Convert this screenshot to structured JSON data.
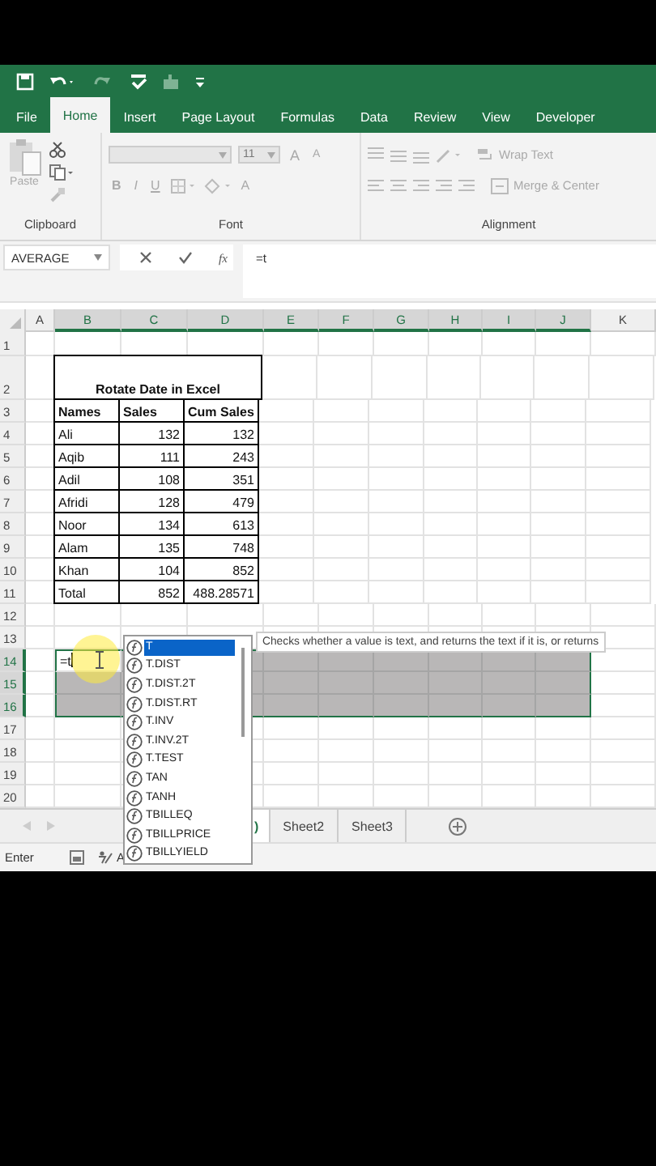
{
  "ribbon_tabs": [
    {
      "label": "File",
      "selected": false
    },
    {
      "label": "Home",
      "selected": true
    },
    {
      "label": "Insert",
      "selected": false
    },
    {
      "label": "Page Layout",
      "selected": false
    },
    {
      "label": "Formulas",
      "selected": false
    },
    {
      "label": "Data",
      "selected": false
    },
    {
      "label": "Review",
      "selected": false
    },
    {
      "label": "View",
      "selected": false
    },
    {
      "label": "Developer",
      "selected": false
    }
  ],
  "ribbon": {
    "paste_label": "Paste",
    "font_size": "11",
    "grow_font": "A",
    "shrink_font": "A",
    "bold": "B",
    "italic": "I",
    "underline": "U",
    "font_color": "A",
    "wrap_text": "Wrap Text",
    "merge_center": "Merge & Center",
    "groups": [
      {
        "label": "Clipboard"
      },
      {
        "label": "Font"
      },
      {
        "label": "Alignment"
      }
    ]
  },
  "formula_bar": {
    "name_box": "AVERAGE",
    "function_label": "fx",
    "formula": "=t"
  },
  "columns": [
    {
      "label": "A",
      "selected": false
    },
    {
      "label": "B",
      "selected": true
    },
    {
      "label": "C",
      "selected": true
    },
    {
      "label": "D",
      "selected": true
    },
    {
      "label": "E",
      "selected": true
    },
    {
      "label": "F",
      "selected": true
    },
    {
      "label": "G",
      "selected": true
    },
    {
      "label": "H",
      "selected": true
    },
    {
      "label": "I",
      "selected": true
    },
    {
      "label": "J",
      "selected": true
    },
    {
      "label": "K",
      "selected": false
    }
  ],
  "rows": [
    {
      "number": "1",
      "selected": false,
      "kind": "empty"
    },
    {
      "number": "2",
      "selected": false,
      "kind": "title",
      "cells": [
        "Rotate Date in Excel"
      ]
    },
    {
      "number": "3",
      "selected": false,
      "kind": "header",
      "cells": [
        "Names",
        "Sales",
        "Cum Sales"
      ]
    },
    {
      "number": "4",
      "selected": false,
      "kind": "body",
      "cells": [
        "Ali",
        "132",
        "132"
      ]
    },
    {
      "number": "5",
      "selected": false,
      "kind": "body",
      "cells": [
        "Aqib",
        "111",
        "243"
      ]
    },
    {
      "number": "6",
      "selected": false,
      "kind": "body",
      "cells": [
        "Adil",
        "108",
        "351"
      ]
    },
    {
      "number": "7",
      "selected": false,
      "kind": "body",
      "cells": [
        "Afridi",
        "128",
        "479"
      ]
    },
    {
      "number": "8",
      "selected": false,
      "kind": "body",
      "cells": [
        "Noor",
        "134",
        "613"
      ]
    },
    {
      "number": "9",
      "selected": false,
      "kind": "body",
      "cells": [
        "Alam",
        "135",
        "748"
      ]
    },
    {
      "number": "10",
      "selected": false,
      "kind": "body",
      "cells": [
        "Khan",
        "104",
        "852"
      ]
    },
    {
      "number": "11",
      "selected": false,
      "kind": "body",
      "cells": [
        "Total",
        "852",
        "488.28571"
      ]
    },
    {
      "number": "12",
      "selected": false,
      "kind": "empty"
    },
    {
      "number": "13",
      "selected": false,
      "kind": "empty"
    },
    {
      "number": "14",
      "selected": true,
      "kind": "input",
      "cells": [
        "=t"
      ]
    },
    {
      "number": "15",
      "selected": true,
      "kind": "empty"
    },
    {
      "number": "16",
      "selected": true,
      "kind": "empty"
    },
    {
      "number": "17",
      "selected": false,
      "kind": "empty"
    },
    {
      "number": "18",
      "selected": false,
      "kind": "empty"
    },
    {
      "number": "19",
      "selected": false,
      "kind": "empty"
    },
    {
      "number": "20",
      "selected": false,
      "kind": "empty"
    }
  ],
  "autocomplete": {
    "items": [
      {
        "label": "T",
        "selected": true
      },
      {
        "label": "T.DIST",
        "selected": false
      },
      {
        "label": "T.DIST.2T",
        "selected": false
      },
      {
        "label": "T.DIST.RT",
        "selected": false
      },
      {
        "label": "T.INV",
        "selected": false
      },
      {
        "label": "T.INV.2T",
        "selected": false
      },
      {
        "label": "T.TEST",
        "selected": false
      },
      {
        "label": "TAN",
        "selected": false
      },
      {
        "label": "TANH",
        "selected": false
      },
      {
        "label": "TBILLEQ",
        "selected": false
      },
      {
        "label": "TBILLPRICE",
        "selected": false
      },
      {
        "label": "TBILLYIELD",
        "selected": false
      }
    ],
    "tooltip": "Checks whether a value is text, and returns the text if it is, or returns"
  },
  "sheet_tabs": [
    {
      "label": ")",
      "selected": true
    },
    {
      "label": "Sheet2",
      "selected": false
    },
    {
      "label": "Sheet3",
      "selected": false
    }
  ],
  "status_bar": {
    "mode": "Enter",
    "accessibility": "A"
  }
}
